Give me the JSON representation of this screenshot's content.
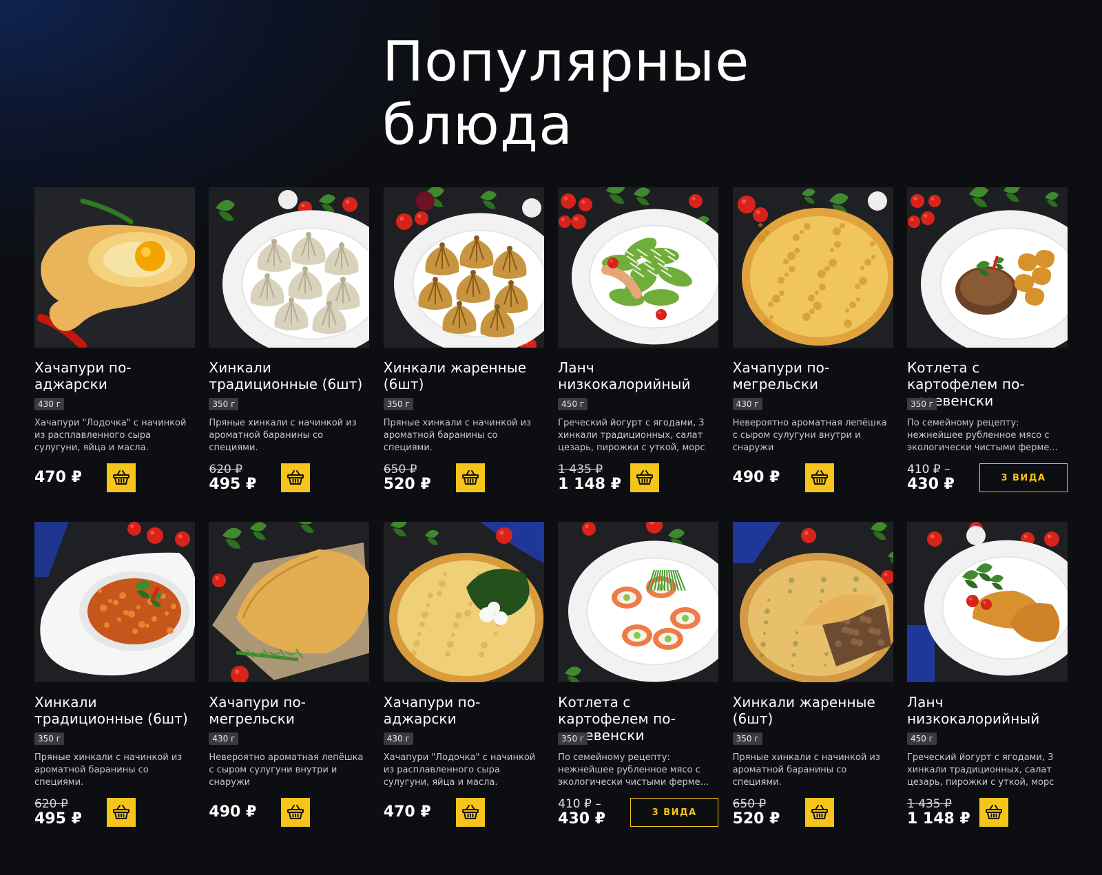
{
  "section": {
    "title_line1": "Популярные",
    "title_line2": "блюда"
  },
  "colors": {
    "accent": "#f5c51b",
    "background": "#0d0e12",
    "badge": "#3a3b40"
  },
  "products": [
    {
      "name": "Хачапури по-аджарски",
      "weight": "430 г",
      "desc": "Хачапури \"Лодочка\" с начинкой из расплавленного сыра сулугуни, яйца и масла.",
      "old_price": "",
      "price": "470 ₽",
      "action": "cart",
      "icon": "cart-icon",
      "image": "adjarian-khachapuri"
    },
    {
      "name": "Хинкали традиционные (6шт)",
      "weight": "350 г",
      "desc": "Пряные хинкали с начинкой из ароматной баранины со специями.",
      "old_price": "620 ₽",
      "price": "495 ₽",
      "action": "cart",
      "icon": "cart-icon",
      "image": "khinkali-boiled"
    },
    {
      "name": "Хинкали жаренные (6шт)",
      "weight": "350 г",
      "desc": "Пряные хинкали с начинкой из ароматной баранины со специями.",
      "old_price": "650 ₽",
      "price": "520 ₽",
      "action": "cart",
      "icon": "cart-icon",
      "image": "khinkali-fried"
    },
    {
      "name": "Ланч низкокалорийный",
      "weight": "450 г",
      "desc": "Греческий йогурт с ягодами, 3 хинкали традиционных, салат цезарь, пирожки с уткой, морс",
      "old_price": "1 435 ₽",
      "price": "1 148 ₽",
      "action": "cart",
      "icon": "cart-icon",
      "image": "caesar-salad"
    },
    {
      "name": "Хачапури по-мегрельски",
      "weight": "430 г",
      "desc": "Невероятно ароматная лепёшка с сыром сулугуни внутри и снаружи",
      "old_price": "",
      "price": "490 ₽",
      "action": "cart",
      "icon": "cart-icon",
      "image": "megrelian-khachapuri"
    },
    {
      "name": "Котлета с картофелем по-деревенски",
      "weight": "350 г",
      "desc": "По семейному рецепту: нежнейшее рубленное мясо с экологически чистыми ферме...",
      "price_from": "410 ₽ –",
      "price": "430 ₽",
      "action": "variants",
      "variants_label": "3 ВИДА",
      "image": "cutlet-potatoes"
    },
    {
      "name": "Хинкали традиционные (6шт)",
      "weight": "350 г",
      "desc": "Пряные хинкали с начинкой из ароматной баранины со специями.",
      "old_price": "620 ₽",
      "price": "495 ₽",
      "action": "cart",
      "icon": "cart-icon",
      "image": "soup-bowl"
    },
    {
      "name": "Хачапури по-мегрельски",
      "weight": "430 г",
      "desc": "Невероятно ароматная лепёшка с сыром сулугуни внутри и снаружи",
      "old_price": "",
      "price": "490 ₽",
      "action": "cart",
      "icon": "cart-icon",
      "image": "cheburek"
    },
    {
      "name": "Хачапури по-аджарски",
      "weight": "430 г",
      "desc": "Хачапури \"Лодочка\" с начинкой из расплавленного сыра сулугуни, яйца и масла.",
      "old_price": "",
      "price": "470 ₽",
      "action": "cart",
      "icon": "cart-icon",
      "image": "cheese-pie"
    },
    {
      "name": "Котлета с картофелем по-деревенски",
      "weight": "350 г",
      "desc": "По семейному рецепту: нежнейшее рубленное мясо с экологически чистыми ферме...",
      "price_from": "410 ₽ –",
      "price": "430 ₽",
      "action": "variants",
      "variants_label": "3 ВИДА",
      "image": "salmon-rolls"
    },
    {
      "name": "Хинкали жаренные (6шт)",
      "weight": "350 г",
      "desc": "Пряные хинкали с начинкой из ароматной баранины со специями.",
      "old_price": "650 ₽",
      "price": "520 ₽",
      "action": "cart",
      "icon": "cart-icon",
      "image": "meat-pie"
    },
    {
      "name": "Ланч низкокалорийный",
      "weight": "450 г",
      "desc": "Греческий йогурт с ягодами, 3 хинкали традиционных, салат цезарь, пирожки с уткой, морс",
      "old_price": "1 435 ₽",
      "price": "1 148 ₽",
      "action": "cart",
      "icon": "cart-icon",
      "image": "pastries-plate"
    }
  ]
}
